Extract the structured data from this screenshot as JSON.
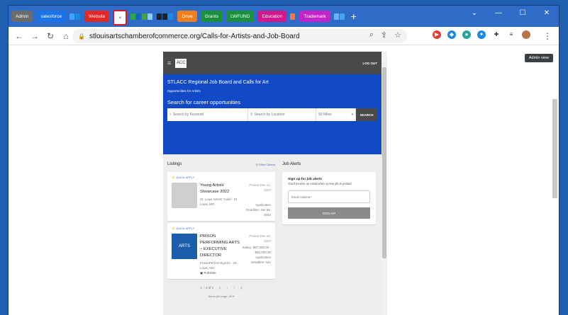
{
  "tabs": [
    {
      "label": "Admin",
      "color": "#6b6b6b"
    },
    {
      "label": "salesforce",
      "color": "#1a73e8"
    },
    {
      "label": "Website",
      "color": "#e32626"
    },
    {
      "label": "Drive",
      "color": "#f0801f"
    },
    {
      "label": "Grants",
      "color": "#1a8f3c"
    },
    {
      "label": "LWFUND",
      "color": "#1a8f3c"
    },
    {
      "label": "Education",
      "color": "#d6168c"
    },
    {
      "label": "Trademark",
      "color": "#c323c7"
    }
  ],
  "active_tab_close": "×",
  "new_tab": "+",
  "address_bar": {
    "url": "stlouisartschamberofcommerce.org/Calls-for-Artists-and-Job-Board"
  },
  "tooltip": "Admin view",
  "site": {
    "logout": "LOG OUT",
    "logo_text": "ACC",
    "hero_title": "STLACC Regional Job Board and Calls for Art",
    "hero_sub": "Opportunities for Artists",
    "search_title": "Search for career opportunities",
    "keyword_placeholder": "Search by Keyword",
    "location_placeholder": "Search by Location",
    "distance": "50 Miles",
    "search_button": "SEARCH"
  },
  "listings": {
    "title": "Listings",
    "filter": "Filter Criteria",
    "quick_apply": "QUICK APPLY",
    "items": [
      {
        "title": "Young Artists' Showcase 2022",
        "org": "St. Louis Artists' Guild - St. Louis, MO",
        "posted": "Posted Dec 22, 2021",
        "detail": "Application Deadline: Jan 29, 2022"
      },
      {
        "title": "PRISON PERFORMING ARTS – EXECUTIVE DIRECTOR",
        "org": "PrisonPerformingArts - St. Louis, MO",
        "posted": "Posted Dec 20, 2021",
        "detail": "Salary: $57,000.00 - $65,000.00 Application Deadline: N/A",
        "type": "Full-time",
        "logo_text": "ARTS"
      }
    ],
    "pager": "1 – 2 of 2",
    "per_page": "Items per page: 20"
  },
  "alerts": {
    "title": "Job Alerts",
    "card_title": "Sign up for job alerts",
    "card_sub": "You'll receive an email when a new job is posted.",
    "email_placeholder": "Email Address *",
    "button": "SIGN UP"
  }
}
